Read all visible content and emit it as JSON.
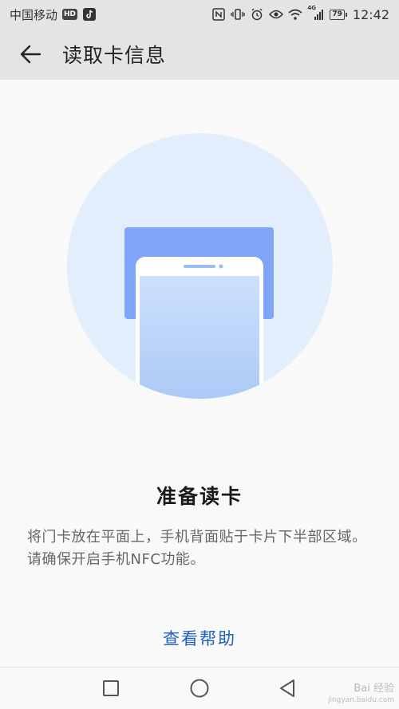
{
  "status_bar": {
    "carrier": "中国移动",
    "hd_badge": "HD",
    "network_type": "4G",
    "battery_level": "79",
    "time": "12:42"
  },
  "app_bar": {
    "title": "读取卡信息"
  },
  "content": {
    "heading": "准备读卡",
    "description": "将门卡放在平面上，手机背面贴于卡片下半部区域。请确保开启手机NFC功能。",
    "help_link": "查看帮助"
  },
  "watermark": {
    "brand": "Bai 经验",
    "url": "jingyan.baidu.com"
  },
  "colors": {
    "circle": "#e3eefc",
    "card": "#7ea5f7",
    "phone_screen_top": "#cde0fb",
    "phone_screen_bottom": "#a6c6f6",
    "link": "#1f5fbf"
  }
}
